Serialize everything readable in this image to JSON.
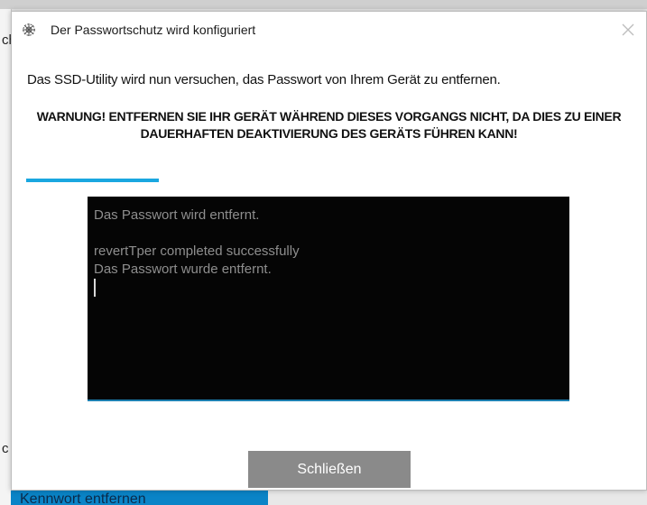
{
  "background": {
    "fragment_top": "ch",
    "fragment_mid": "c",
    "bottom_button_label": "Kennwort entfernen"
  },
  "dialog": {
    "title": "Der Passwortschutz wird konfiguriert",
    "title_icon": "gear-icon",
    "close_icon": "close-icon",
    "message": "Das SSD-Utility wird nun versuchen, das Passwort von Ihrem Gerät zu entfernen.",
    "warning": "WARNUNG! ENTFERNEN SIE IHR GERÄT WÄHREND DIESES VORGANGS NICHT, DA DIES ZU EINER DAUERHAFTEN DEAKTIVIERUNG DES GERÄTS FÜHREN KANN!",
    "progress_fraction": 0.23,
    "progress_color": "#1aa7e0",
    "console_lines": [
      "Das Passwort wird entfernt.",
      "",
      "revertTper completed successfully",
      "Das Passwort wurde entfernt."
    ],
    "close_button_label": "Schließen"
  }
}
